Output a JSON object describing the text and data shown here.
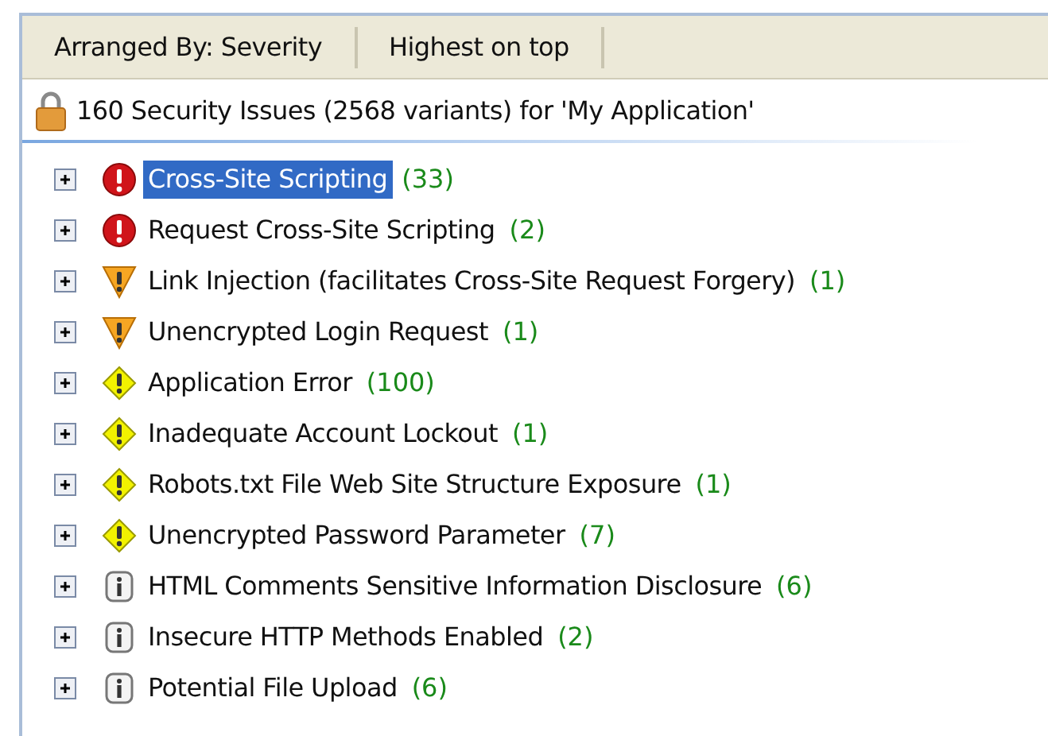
{
  "header": {
    "columns": [
      "Arranged By: Severity",
      "Highest on top"
    ]
  },
  "summary": "160 Security Issues (2568 variants) for 'My Application'",
  "issues": [
    {
      "kind": "high",
      "name": "Cross-Site Scripting",
      "count": "(33)",
      "selected": true
    },
    {
      "kind": "high",
      "name": "Request Cross-Site Scripting",
      "count": "(2)",
      "selected": false
    },
    {
      "kind": "medium",
      "name": "Link Injection (facilitates Cross-Site Request Forgery)",
      "count": "(1)",
      "selected": false
    },
    {
      "kind": "medium",
      "name": "Unencrypted Login Request",
      "count": "(1)",
      "selected": false
    },
    {
      "kind": "low",
      "name": "Application Error",
      "count": "(100)",
      "selected": false
    },
    {
      "kind": "low",
      "name": "Inadequate Account Lockout",
      "count": "(1)",
      "selected": false
    },
    {
      "kind": "low",
      "name": "Robots.txt File Web Site Structure Exposure",
      "count": "(1)",
      "selected": false
    },
    {
      "kind": "low",
      "name": "Unencrypted Password Parameter",
      "count": "(7)",
      "selected": false
    },
    {
      "kind": "info",
      "name": "HTML Comments Sensitive Information Disclosure",
      "count": "(6)",
      "selected": false
    },
    {
      "kind": "info",
      "name": "Insecure HTTP Methods Enabled",
      "count": "(2)",
      "selected": false
    },
    {
      "kind": "info",
      "name": "Potential File Upload",
      "count": "(6)",
      "selected": false
    }
  ]
}
